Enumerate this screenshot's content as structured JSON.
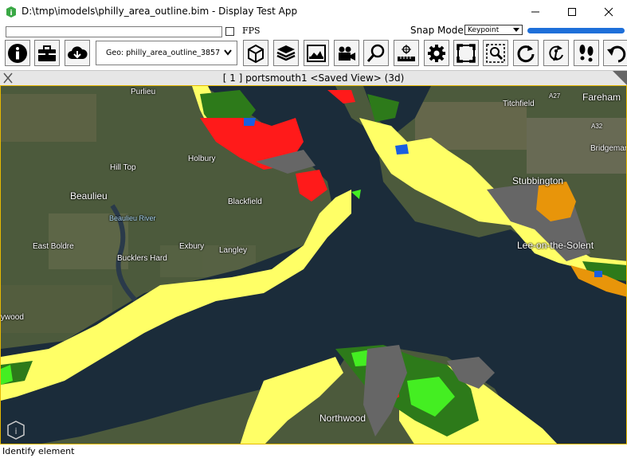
{
  "window": {
    "title": "D:\\tmp\\imodels\\philly_area_outline.bim - Display Test App"
  },
  "topbar": {
    "fps_label": "FPS",
    "snap_label": "Snap Mode:",
    "snap_value": "Keypoint",
    "progress_color": "#1e6fd9"
  },
  "toolbar": {
    "geo_select_value": "Geo: philly_area_outline_3857",
    "icons": [
      "info-icon",
      "toolbox-icon",
      "cloud-download-icon",
      "cube-icon",
      "layers-icon",
      "image-icon",
      "camera-icon",
      "zoom-icon",
      "measure-icon",
      "settings-icon",
      "fit-view-icon",
      "window-zoom-icon",
      "rotate-icon",
      "walk-rotate-icon",
      "footsteps-icon",
      "undo-icon"
    ]
  },
  "view": {
    "title": "[ 1 ] portsmouth1 <Saved View> (3d)"
  },
  "map": {
    "labels": [
      {
        "text": "Purlieu"
      },
      {
        "text": "Holbury"
      },
      {
        "text": "Hill Top"
      },
      {
        "text": "Beaulieu"
      },
      {
        "text": "Beaulieu River"
      },
      {
        "text": "Blackfield"
      },
      {
        "text": "East Boldre"
      },
      {
        "text": "Bucklers Hard"
      },
      {
        "text": "Exbury"
      },
      {
        "text": "Langley"
      },
      {
        "text": "Titchfield"
      },
      {
        "text": "Fareham"
      },
      {
        "text": "Bridgemary"
      },
      {
        "text": "Stubbington"
      },
      {
        "text": "Lee-on-the-Solent"
      },
      {
        "text": "Northwood"
      },
      {
        "text": "ywood"
      },
      {
        "text": "A27"
      },
      {
        "text": "A32"
      }
    ],
    "colors": {
      "water": "#1a2b3a",
      "land": "#4a5a3a",
      "yellow_zone": "#ffff66",
      "red_zone": "#ff1a1a",
      "green_zone": "#2d7a1a",
      "lime_zone": "#44ee22",
      "gray_zone": "#666666",
      "orange_zone": "#e8950a",
      "blue_zone": "#1a5fe0"
    }
  },
  "status": {
    "text": "Identify element"
  }
}
